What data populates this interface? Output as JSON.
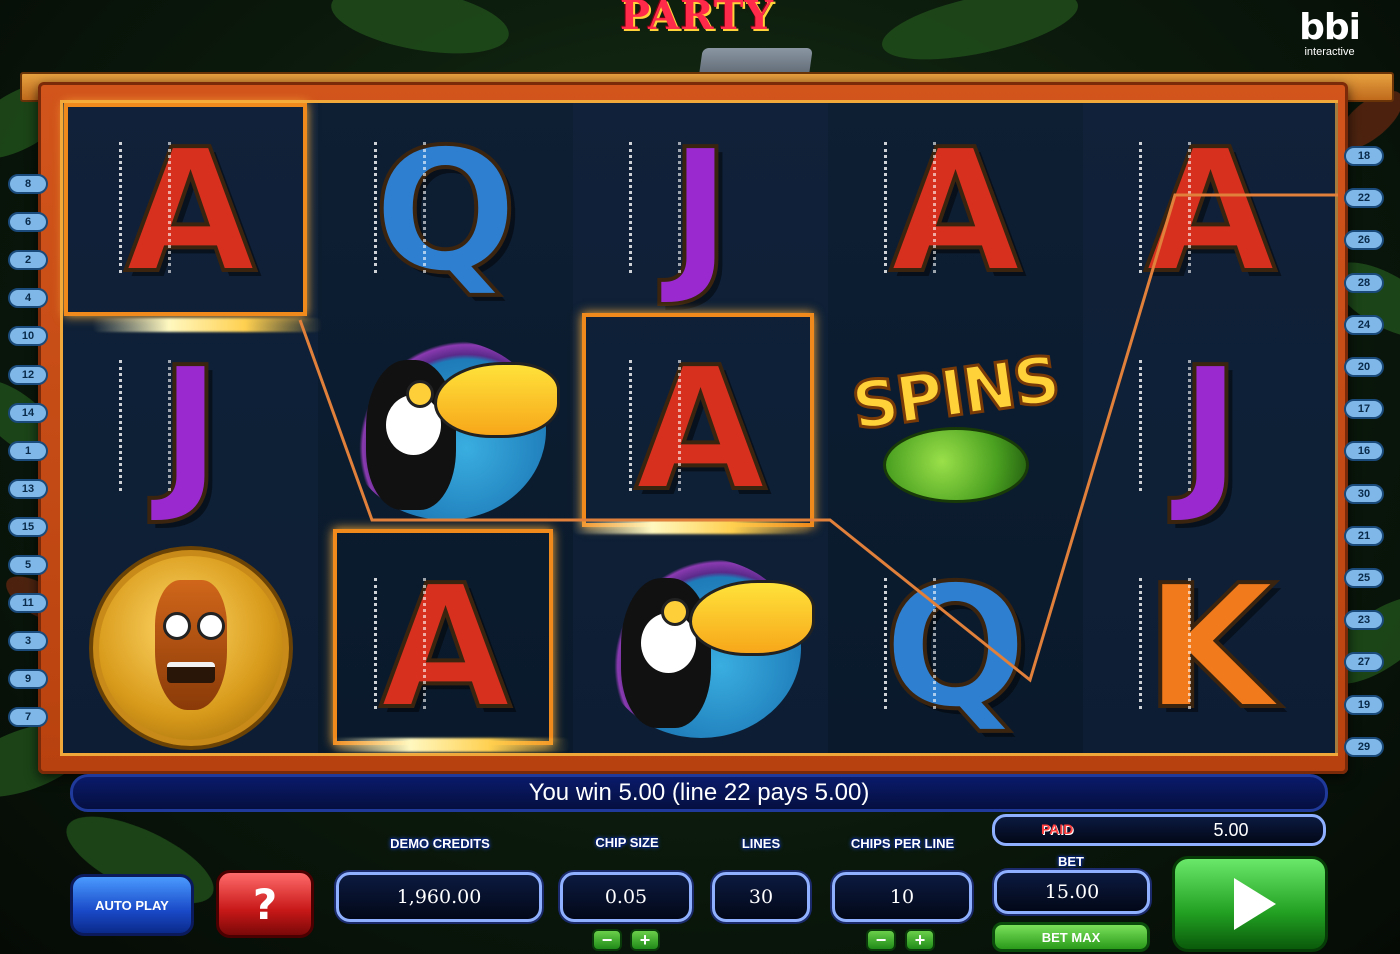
{
  "game": {
    "logo_text": "PARTY",
    "brand_name": "bbi",
    "brand_sub": "interactive"
  },
  "reels": [
    [
      "A-red",
      "J-purple",
      "mask-coin"
    ],
    [
      "Q-blue",
      "toucan",
      "A-red"
    ],
    [
      "J-purple",
      "A-red",
      "toucan"
    ],
    [
      "A-red",
      "spins-snake",
      "Q-blue"
    ],
    [
      "A-red",
      "J-purple",
      "K-orange"
    ]
  ],
  "symbols": {
    "A-red": {
      "label": "A",
      "color": "#d8301e"
    },
    "J-purple": {
      "label": "J",
      "color": "#9a2ad0"
    },
    "Q-blue": {
      "label": "Q",
      "color": "#2f7fd0"
    },
    "K-orange": {
      "label": "K",
      "color": "#f07a1c"
    },
    "spins-word": "SPINS"
  },
  "paylines": {
    "left": [
      "8",
      "6",
      "2",
      "4",
      "10",
      "12",
      "14",
      "1",
      "13",
      "15",
      "5",
      "11",
      "3",
      "9",
      "7"
    ],
    "right": [
      "18",
      "22",
      "26",
      "28",
      "24",
      "20",
      "17",
      "16",
      "30",
      "21",
      "25",
      "23",
      "27",
      "19",
      "29"
    ]
  },
  "win_message": "You win  5.00 (line 22 pays  5.00)",
  "controls": {
    "autoplay_label": "AUTO PLAY",
    "help_label": "?",
    "demo_credits_label": "DEMO CREDITS",
    "demo_credits_value": "1,960.00",
    "chip_size_label": "CHIP SIZE",
    "chip_size_value": "0.05",
    "lines_label": "LINES",
    "lines_value": "30",
    "chips_per_line_label": "CHIPS PER LINE",
    "chips_per_line_value": "10",
    "paid_label": "PAID",
    "paid_value": "5.00",
    "bet_label": "BET",
    "bet_value": "15.00",
    "bet_max_label": "BET MAX",
    "minus": "−",
    "plus": "+"
  },
  "colors": {
    "frame": "#c84a14",
    "highlight": "#f08a1c",
    "panel_border": "#8fb0ff",
    "spin_button": "#22a022"
  }
}
